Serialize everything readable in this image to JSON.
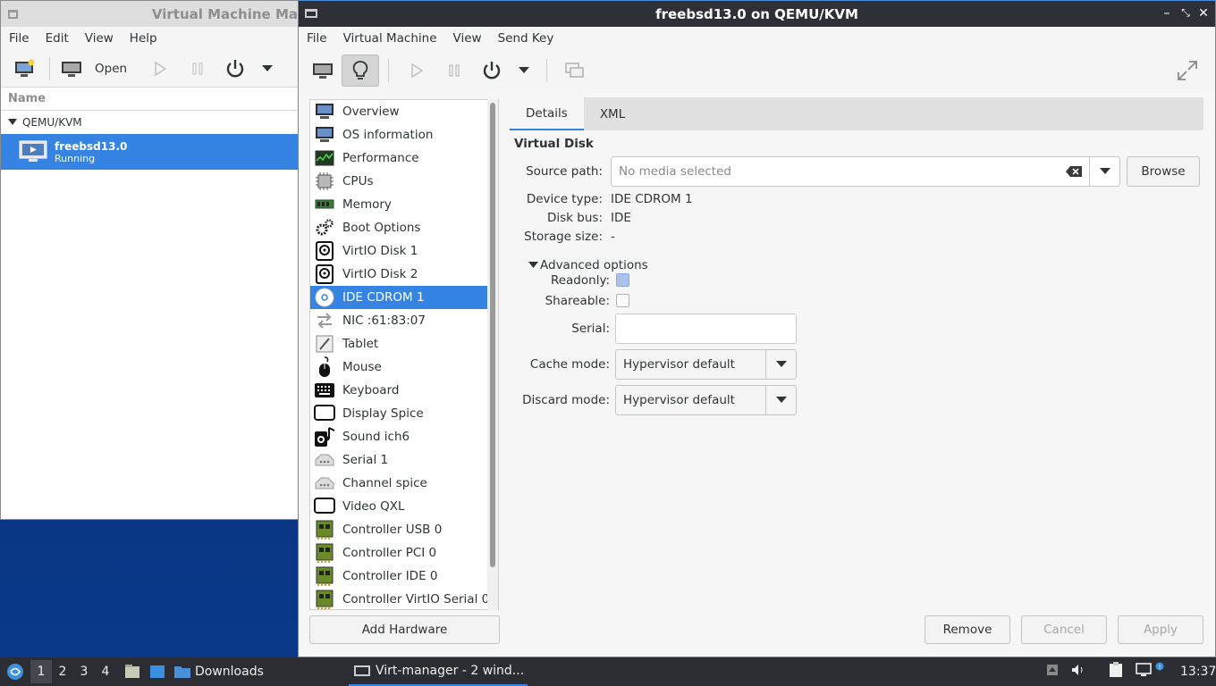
{
  "vmm": {
    "title": "Virtual Machine Ma",
    "menu": [
      "File",
      "Edit",
      "View",
      "Help"
    ],
    "open_label": "Open",
    "col_name": "Name",
    "group": "QEMU/KVM",
    "vm_name": "freebsd13.0",
    "vm_state": "Running"
  },
  "main": {
    "title": "freebsd13.0 on QEMU/KVM",
    "menu": [
      "File",
      "Virtual Machine",
      "View",
      "Send Key"
    ],
    "hardware": [
      "Overview",
      "OS information",
      "Performance",
      "CPUs",
      "Memory",
      "Boot Options",
      "VirtIO Disk 1",
      "VirtIO Disk 2",
      "IDE CDROM 1",
      "NIC :61:83:07",
      "Tablet",
      "Mouse",
      "Keyboard",
      "Display Spice",
      "Sound ich6",
      "Serial 1",
      "Channel spice",
      "Video QXL",
      "Controller USB 0",
      "Controller PCI 0",
      "Controller IDE 0",
      "Controller VirtIO Serial 0"
    ],
    "hardware_icons": [
      "monitor-icon",
      "monitor-icon",
      "performance-icon",
      "cpu-icon",
      "memory-icon",
      "gears-icon",
      "disk-icon",
      "disk-icon",
      "cdrom-icon",
      "network-icon",
      "tablet-icon",
      "mouse-icon",
      "keyboard-icon",
      "display-icon",
      "sound-icon",
      "serial-icon",
      "serial-icon",
      "display-icon",
      "controller-icon",
      "controller-icon",
      "controller-icon",
      "controller-icon"
    ],
    "selected_index": 8,
    "add_hardware": "Add Hardware",
    "tabs": [
      "Details",
      "XML"
    ],
    "section": "Virtual Disk",
    "source_path_label": "Source path:",
    "source_path_placeholder": "No media selected",
    "browse": "Browse",
    "device_type_label": "Device type:",
    "device_type": "IDE CDROM 1",
    "disk_bus_label": "Disk bus:",
    "disk_bus": "IDE",
    "storage_size_label": "Storage size:",
    "storage_size": "-",
    "advanced": "Advanced options",
    "readonly_label": "Readonly:",
    "shareable_label": "Shareable:",
    "serial_label": "Serial:",
    "cache_label": "Cache mode:",
    "cache_value": "Hypervisor default",
    "discard_label": "Discard mode:",
    "discard_value": "Hypervisor default",
    "remove": "Remove",
    "cancel": "Cancel",
    "apply": "Apply"
  },
  "taskbar": {
    "workspaces": [
      "1",
      "2",
      "3",
      "4"
    ],
    "downloads": "Downloads",
    "task": "Virt-manager - 2 wind...",
    "clock": "13:37"
  },
  "colors": {
    "accent": "#3584e4",
    "titlebar": "#2d3137",
    "taskbar": "#2b2d32"
  }
}
